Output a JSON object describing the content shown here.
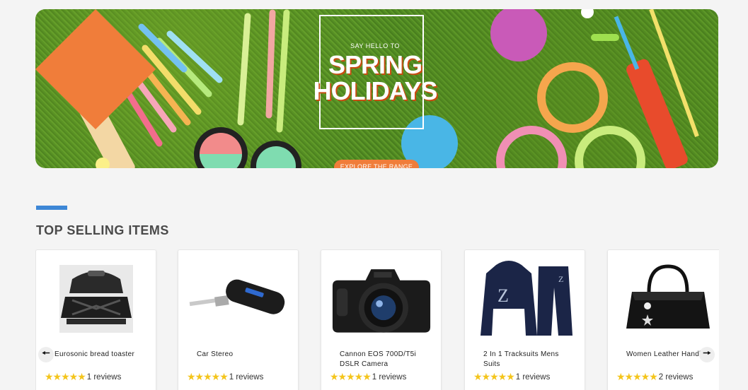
{
  "banner": {
    "tagline": "SAY HELLO TO",
    "headline_line1": "SPRING",
    "headline_line2": "HOLIDAYS",
    "cta_label": "EXPLORE THE RANGE",
    "accent_color": "#f07d3a"
  },
  "section": {
    "title": "TOP SELLING ITEMS",
    "accent_color": "#3d87d6"
  },
  "carousel": {
    "prev_icon": "arrow-left-icon",
    "next_icon": "arrow-right-icon"
  },
  "products": [
    {
      "name": "Eurosonic bread toaster",
      "stars": "★★★★★",
      "reviews": "1 reviews",
      "image_icon": "sandwich-toaster-icon"
    },
    {
      "name": "Car Stereo",
      "stars": "★★★★★",
      "reviews": "1 reviews",
      "image_icon": "bluetooth-receiver-icon"
    },
    {
      "name": "Cannon EOS 700D/T5i DSLR Camera",
      "stars": "★★★★★",
      "reviews": "1 reviews",
      "image_icon": "camera-icon"
    },
    {
      "name": "2 In 1 Tracksuits Mens Suits",
      "stars": "★★★★★",
      "reviews": "1 reviews",
      "image_icon": "tracksuit-icon"
    },
    {
      "name": "Women Leather Handbag",
      "stars": "★★★★★",
      "reviews": "2 reviews",
      "image_icon": "handbag-icon"
    }
  ]
}
